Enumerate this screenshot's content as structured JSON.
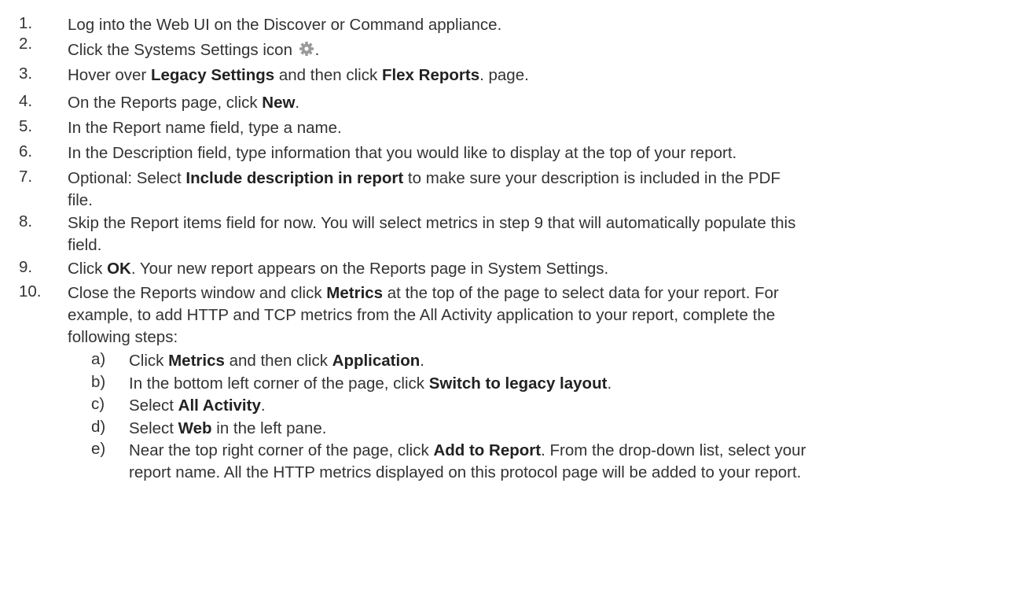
{
  "steps": [
    {
      "num": "1.",
      "lines": [
        [
          {
            "t": "Log into the Web UI on the Discover or Command appliance."
          }
        ]
      ]
    },
    {
      "num": "2.",
      "lines": [
        [
          {
            "t": "Click the Systems Settings icon "
          },
          {
            "icon": "gear-icon"
          },
          {
            "t": "."
          }
        ]
      ]
    },
    {
      "num": "3.",
      "lines": [
        [
          {
            "t": "Hover over "
          },
          {
            "b": "Legacy Settings"
          },
          {
            "t": " and then click "
          },
          {
            "b": "Flex Reports"
          },
          {
            "t": ". page."
          }
        ]
      ]
    },
    {
      "num": "4.",
      "lines": [
        [
          {
            "t": "On the Reports page, click "
          },
          {
            "b": "New"
          },
          {
            "t": "."
          }
        ]
      ]
    },
    {
      "num": "5.",
      "lines": [
        [
          {
            "t": "In the Report name field, type a name."
          }
        ]
      ]
    },
    {
      "num": "6.",
      "lines": [
        [
          {
            "t": "In the Description field, type information that you would like to display at the top of your report."
          }
        ]
      ]
    },
    {
      "num": "7.",
      "lines": [
        [
          {
            "t": "Optional: Select "
          },
          {
            "b": "Include description in report"
          },
          {
            "t": " to make sure your description is included in the PDF"
          }
        ],
        [
          {
            "t": "file."
          }
        ]
      ]
    },
    {
      "num": "8.",
      "lines": [
        [
          {
            "t": "Skip the Report items field for now. You will select metrics in step 9 that will automatically populate this"
          }
        ],
        [
          {
            "t": "field."
          }
        ]
      ]
    },
    {
      "num": "9.",
      "lines": [
        [
          {
            "t": "Click "
          },
          {
            "b": "OK"
          },
          {
            "t": ". Your new report appears on the Reports page in System Settings."
          }
        ]
      ]
    },
    {
      "num": "10.",
      "lines": [
        [
          {
            "t": "Close the Reports window and click "
          },
          {
            "b": "Metrics"
          },
          {
            "t": " at the top of the page to select data for your report. For"
          }
        ],
        [
          {
            "t": "example, to add HTTP and TCP metrics from the All Activity application to your report, complete the"
          }
        ],
        [
          {
            "t": "following steps:"
          }
        ]
      ],
      "substeps": [
        {
          "label": "a)",
          "lines": [
            [
              {
                "t": "Click "
              },
              {
                "b": "Metrics"
              },
              {
                "t": " and then click "
              },
              {
                "b": "Application"
              },
              {
                "t": "."
              }
            ]
          ]
        },
        {
          "label": "b)",
          "lines": [
            [
              {
                "t": "In the bottom left corner of the page, click "
              },
              {
                "b": "Switch to legacy layout"
              },
              {
                "t": "."
              }
            ]
          ]
        },
        {
          "label": "c)",
          "lines": [
            [
              {
                "t": "Select "
              },
              {
                "b": "All Activity"
              },
              {
                "t": "."
              }
            ]
          ]
        },
        {
          "label": "d)",
          "lines": [
            [
              {
                "t": "Select "
              },
              {
                "b": "Web"
              },
              {
                "t": " in the left pane."
              }
            ]
          ]
        },
        {
          "label": "e)",
          "lines": [
            [
              {
                "t": "Near the top right corner of the page, click "
              },
              {
                "b": "Add to Report"
              },
              {
                "t": ". From the drop-down list, select your"
              }
            ],
            [
              {
                "t": "report name. All the HTTP metrics displayed on this protocol page will be added to your report."
              }
            ]
          ]
        }
      ]
    }
  ]
}
